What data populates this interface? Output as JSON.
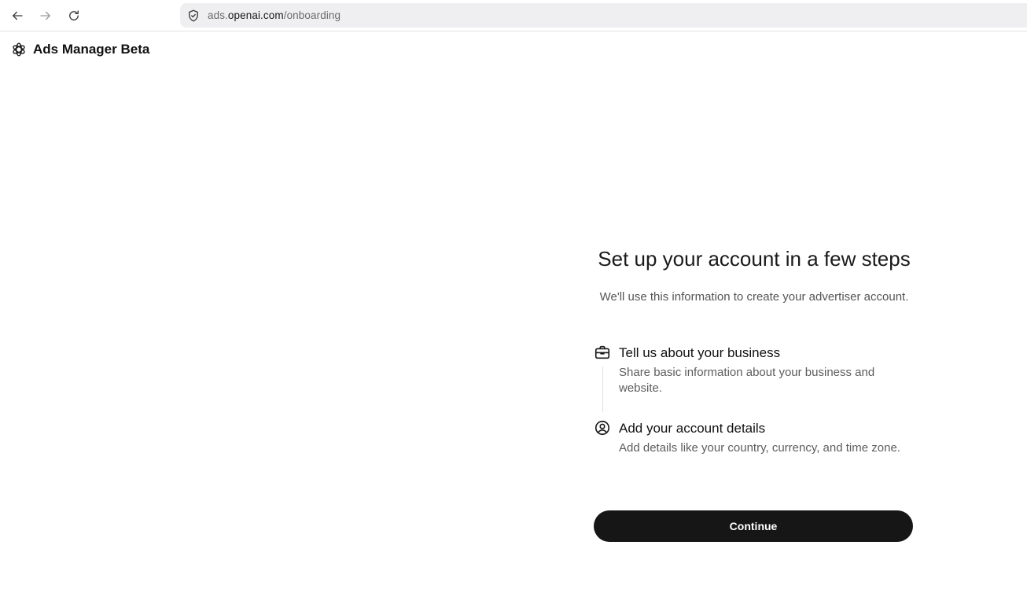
{
  "browser": {
    "url_scheme_prefix": "ads.",
    "url_host": "openai.com",
    "url_path": "/onboarding"
  },
  "header": {
    "title": "Ads Manager Beta"
  },
  "onboarding": {
    "title": "Set up your account in a few steps",
    "subtitle": "We'll use this information to create your advertiser account.",
    "steps": [
      {
        "icon": "briefcase-icon",
        "title": "Tell us about your business",
        "description": "Share basic information about your business and website."
      },
      {
        "icon": "user-circle-icon",
        "title": "Add your account details",
        "description": "Add details like your country, currency, and time zone."
      }
    ],
    "continue_label": "Continue"
  },
  "colors": {
    "button_bg": "#161616",
    "button_text": "#ffffff",
    "address_bar_bg": "#efeff1"
  }
}
